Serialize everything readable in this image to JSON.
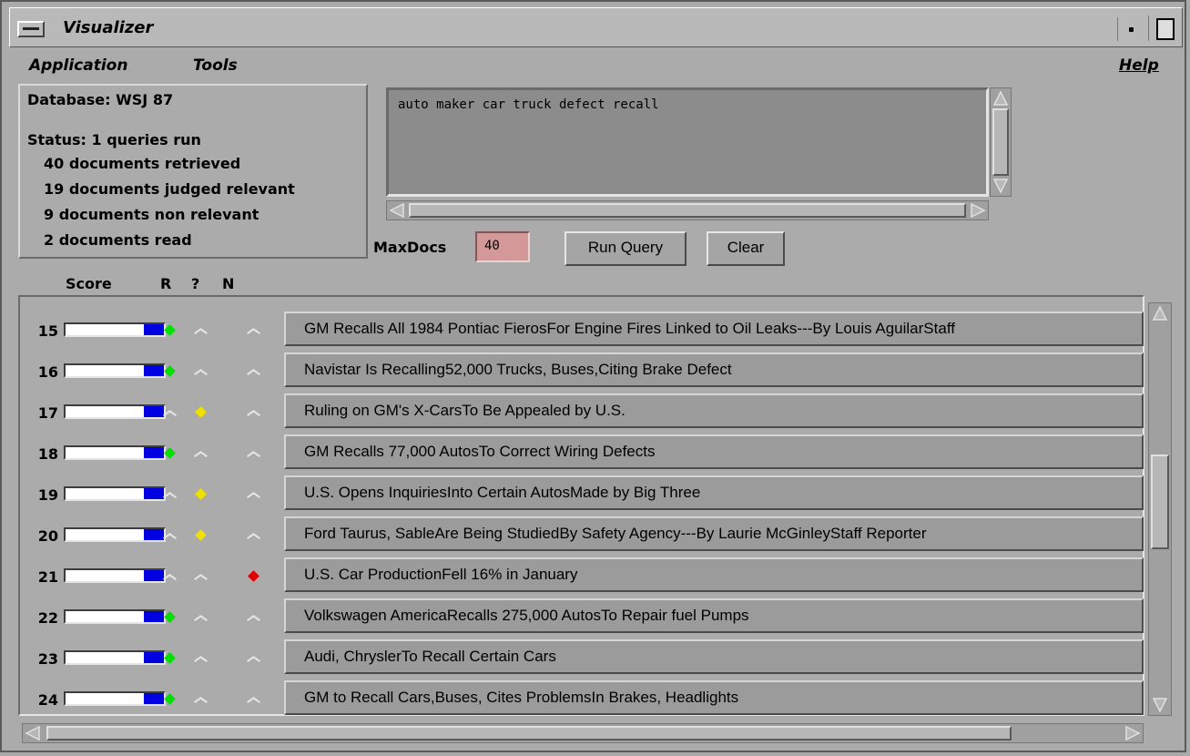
{
  "window": {
    "title": "Visualizer"
  },
  "menubar": {
    "application": "Application",
    "tools": "Tools",
    "help": "Help"
  },
  "info": {
    "database": "Database: WSJ 87",
    "status": "Status: 1 queries run",
    "retrieved": "40  documents retrieved",
    "judged_relevant": "19 documents judged relevant",
    "non_relevant": "9 documents non relevant",
    "read": "2 documents read"
  },
  "query": {
    "text": "auto maker car truck defect recall"
  },
  "controls": {
    "maxdocs_label": "MaxDocs",
    "maxdocs_value": "40",
    "run_label": "Run Query",
    "clear_label": "Clear"
  },
  "columns": {
    "score": "Score",
    "r": "R",
    "q": "?",
    "n": "N"
  },
  "colors": {
    "relevant": "#00e000",
    "unsure": "#f0e000",
    "nonrelevant": "#e00000",
    "score_fill": "#0000e0"
  },
  "results": [
    {
      "rank": "15",
      "score": 0.55,
      "judgment": "R",
      "title": "GM Recalls All 1984 Pontiac FierosFor Engine Fires Linked to Oil Leaks---By Louis AguilarStaff"
    },
    {
      "rank": "16",
      "score": 0.55,
      "judgment": "R",
      "title": "Navistar Is Recalling52,000 Trucks, Buses,Citing Brake Defect"
    },
    {
      "rank": "17",
      "score": 0.55,
      "judgment": "?",
      "title": "Ruling on GM's X-CarsTo Be Appealed by U.S."
    },
    {
      "rank": "18",
      "score": 0.55,
      "judgment": "R",
      "title": "GM Recalls 77,000 AutosTo Correct Wiring Defects"
    },
    {
      "rank": "19",
      "score": 0.55,
      "judgment": "?",
      "title": "U.S. Opens InquiriesInto Certain AutosMade by Big Three"
    },
    {
      "rank": "20",
      "score": 0.55,
      "judgment": "?",
      "title": "Ford Taurus, SableAre Being StudiedBy Safety Agency---By Laurie McGinleyStaff Reporter"
    },
    {
      "rank": "21",
      "score": 0.55,
      "judgment": "N",
      "title": "U.S. Car ProductionFell 16% in January"
    },
    {
      "rank": "22",
      "score": 0.55,
      "judgment": "R",
      "title": "Volkswagen AmericaRecalls 275,000 AutosTo Repair fuel Pumps"
    },
    {
      "rank": "23",
      "score": 0.55,
      "judgment": "R",
      "title": "Audi, ChryslerTo Recall Certain Cars"
    },
    {
      "rank": "24",
      "score": 0.55,
      "judgment": "R",
      "title": "GM to Recall Cars,Buses, Cites ProblemsIn Brakes, Headlights"
    }
  ]
}
